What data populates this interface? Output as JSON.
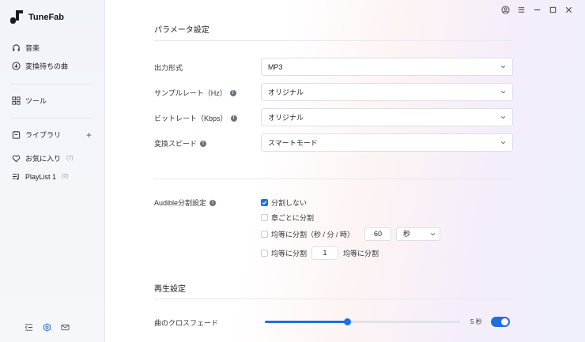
{
  "app": {
    "name": "TuneFab",
    "brand_color": "#1f6fde"
  },
  "sidebar": {
    "items": [
      {
        "label": "音楽",
        "icon": "headphones-icon"
      },
      {
        "label": "変換待ちの曲",
        "icon": "download-icon"
      },
      {
        "label": "ツール",
        "icon": "grid-icon"
      },
      {
        "label": "ライブラリ",
        "icon": "library-icon"
      },
      {
        "label": "お気に入り",
        "count": "(7)",
        "icon": "heart-icon"
      },
      {
        "label": "PlayList 1",
        "count": "(0)",
        "icon": "playlist-icon"
      }
    ],
    "add_symbol": "+"
  },
  "settings": {
    "param_title": "パラメータ設定",
    "output_format": {
      "label": "出力形式",
      "value": "MP3"
    },
    "sample_rate": {
      "label": "サンプルレート（Hz）",
      "value": "オリジナル"
    },
    "bitrate": {
      "label": "ビットレート（Kbps）",
      "value": "オリジナル"
    },
    "speed": {
      "label": "変換スピード",
      "value": "スマートモード"
    },
    "audible": {
      "label": "Audible分割設定",
      "options": {
        "no_split": "分割しない",
        "by_chapter": "章ごとに分割",
        "by_time": "均等に分割（秒 / 分 / 時）",
        "time_value": "60",
        "time_unit": "秒",
        "even_prefix": "均等に分割",
        "even_value": "1",
        "even_suffix": "均等に分割"
      }
    },
    "playback_title": "再生設定",
    "crossfade": {
      "label": "曲のクロスフェード",
      "value_text": "5 秒",
      "level": 0.42,
      "enabled": true
    }
  }
}
